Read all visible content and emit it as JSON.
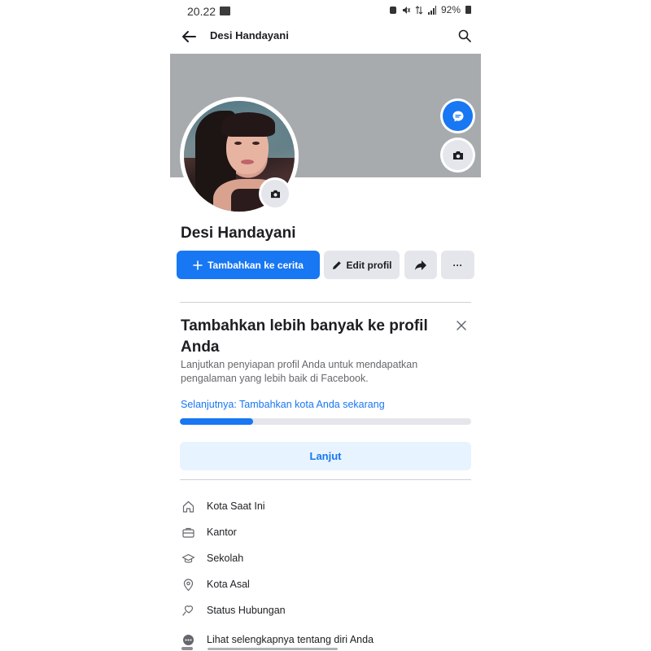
{
  "status_bar": {
    "time": "20.22",
    "battery": "92%"
  },
  "header": {
    "title": "Desi Handayani"
  },
  "profile": {
    "name": "Desi Handayani"
  },
  "actions": {
    "add_story": "Tambahkan ke cerita",
    "edit_profile": "Edit profil",
    "more": "···"
  },
  "completion_card": {
    "title": "Tambahkan lebih banyak ke profil Anda",
    "description": "Lanjutkan penyiapan profil Anda untuk mendapatkan pengalaman yang lebih baik di Facebook.",
    "next_step": "Selanjutnya: Tambahkan kota Anda sekarang",
    "progress_fraction": 0.25,
    "continue_label": "Lanjut"
  },
  "info_items": [
    {
      "label": "Kota Saat Ini",
      "icon": "home-icon"
    },
    {
      "label": "Kantor",
      "icon": "briefcase-icon"
    },
    {
      "label": "Sekolah",
      "icon": "graduation-cap-icon"
    },
    {
      "label": "Kota Asal",
      "icon": "location-pin-icon"
    },
    {
      "label": "Status Hubungan",
      "icon": "relationship-icon"
    },
    {
      "label": "Lihat selengkapnya tentang diri Anda",
      "icon": "more-dots-icon"
    }
  ],
  "colors": {
    "brand": "#1877f2",
    "cover": "#a8abae",
    "button_gray": "#e4e6eb",
    "light_blue": "#e7f3ff"
  }
}
